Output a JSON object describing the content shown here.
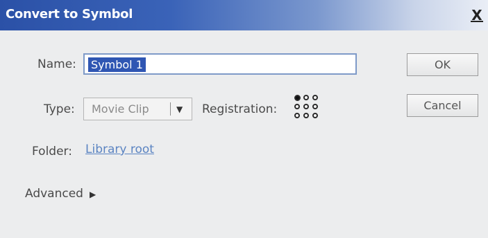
{
  "dialog": {
    "title": "Convert to Symbol",
    "close_label": "X"
  },
  "form": {
    "name_label": "Name:",
    "name_value": "Symbol 1",
    "type_label": "Type:",
    "type_value": "Movie Clip",
    "registration_label": "Registration:",
    "registration_selected": "top-left",
    "folder_label": "Folder:",
    "folder_value": "Library root",
    "advanced_label": "Advanced"
  },
  "buttons": {
    "ok_label": "OK",
    "cancel_label": "Cancel"
  },
  "icons": {
    "dropdown": "dropdown-arrow-icon",
    "expand": "expand-triangle-icon",
    "registration": "registration-grid-icon"
  },
  "colors": {
    "title_gradient_start": "#2b51a7",
    "selection_highlight": "#2f56b3",
    "link": "#5b84c2",
    "input_border": "#7e9ac8"
  }
}
